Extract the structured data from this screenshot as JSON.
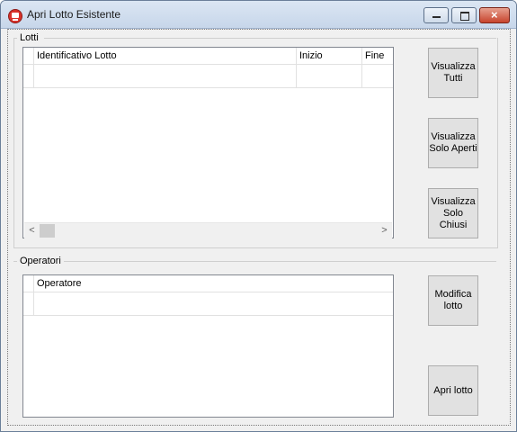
{
  "window": {
    "title": "Apri Lotto Esistente",
    "app_icon": "app-icon",
    "controls": {
      "minimize": "minimize-icon",
      "maximize": "maximize-icon",
      "close": "close-icon"
    }
  },
  "lotti": {
    "label": "Lotti",
    "columns": [
      "Identificativo Lotto",
      "Inizio",
      "Fine"
    ],
    "rows": [],
    "scroll_left": "<",
    "scroll_right": ">"
  },
  "operatori": {
    "label": "Operatori",
    "columns": [
      "Operatore"
    ],
    "rows": []
  },
  "buttons": {
    "visualizza_tutti": "Visualizza\nTutti",
    "visualizza_aperti": "Visualizza\nSolo Aperti",
    "visualizza_chiusi": "Visualizza\nSolo Chiusi",
    "modifica_lotto": "Modifica\nlotto",
    "apri_lotto": "Apri lotto"
  },
  "colors": {
    "title_bar": "#c7d6ea",
    "close_button": "#c7432d",
    "window_bg": "#f0f0f0"
  }
}
